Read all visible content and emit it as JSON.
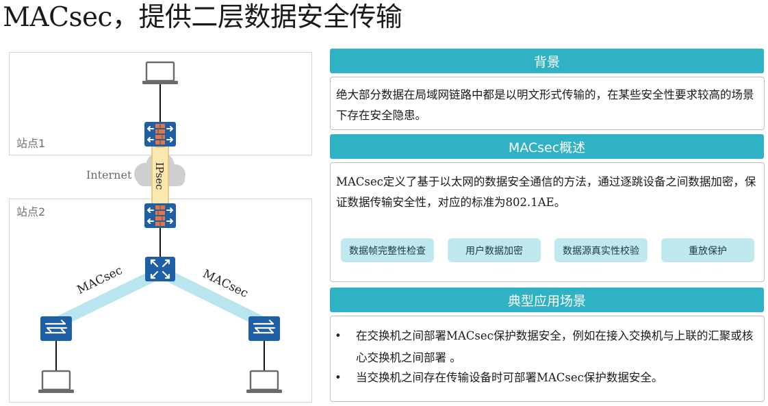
{
  "title": "MACsec，提供二层数据安全传输",
  "diagram": {
    "site1_label": "站点1",
    "site2_label": "站点2",
    "internet_label": "Internet",
    "ipsec_label": "IPsec",
    "macsec_left_label": "MACsec",
    "macsec_right_label": "MACsec",
    "colors": {
      "device_blue": "#1f5fa6",
      "tunnel_cyan": "#b9e6ee",
      "ipsec_fill": "#fbe7b0",
      "cloud_gray": "#cfcfcf"
    }
  },
  "background": {
    "header": "背景",
    "text": "绝大部分数据在局域网链路中都是以明文形式传输的，在某些安全性要求较高的场景下存在安全隐患。"
  },
  "overview": {
    "header": "MACsec概述",
    "text": "MACsec定义了基于以太网的数据安全通信的方法，通过逐跳设备之间数据加密，保证数据传输安全性，对应的标准为802.1AE。",
    "features": [
      "数据帧完整性检查",
      "用户数据加密",
      "数据源真实性校验",
      "重放保护"
    ]
  },
  "scenarios": {
    "header": "典型应用场景",
    "bullet_symbol": "•",
    "items": [
      "在交换机之间部署MACsec保护数据安全，例如在接入交换机与上联的汇聚或核心交换机之间部署 。",
      "当交换机之间存在传输设备时可部署MACsec保护数据安全。"
    ]
  },
  "accent_color": "#2fb3c4",
  "chip_color": "#bfe9ee"
}
